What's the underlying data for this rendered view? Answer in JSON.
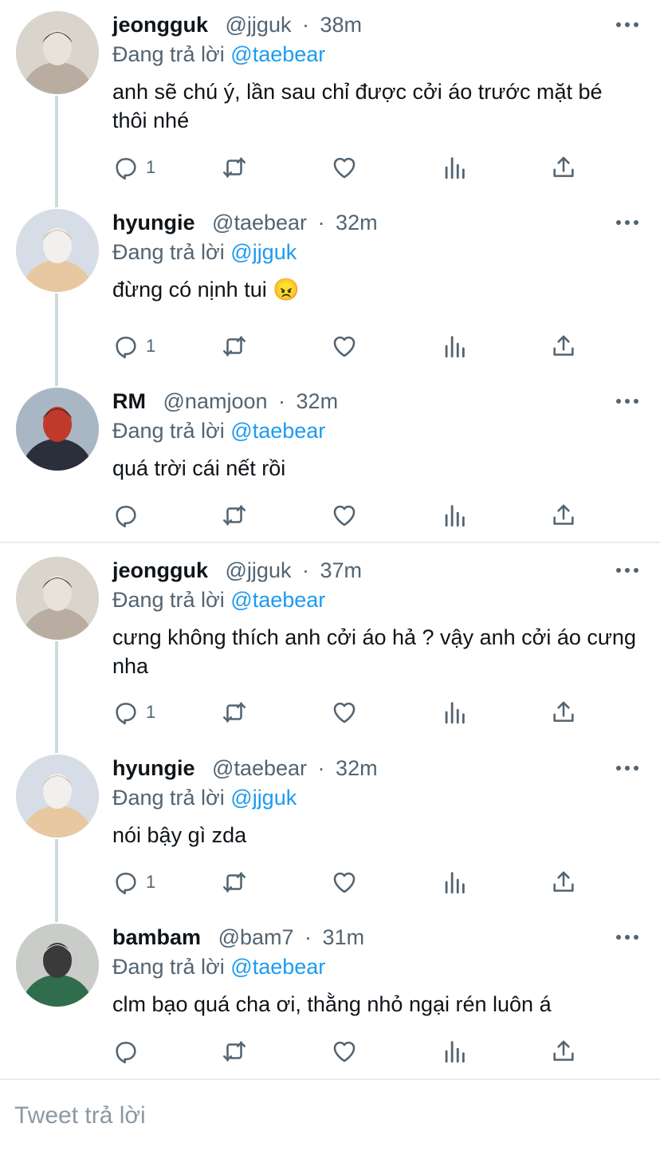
{
  "colors": {
    "text": "#0f1419",
    "secondary": "#536471",
    "accent": "#1d9bf0",
    "thread_line": "#cfd9de",
    "divider": "#e6ecf0"
  },
  "tweets": [
    {
      "name": "jeongguk",
      "handle": "@jjguk",
      "time": "38m",
      "reply_prefix": "Đang trả lời",
      "reply_to": "@taebear",
      "text": "anh sẽ chú ý, lần sau chỉ được cởi áo trước mặt bé thôi nhé",
      "reply_count": "1",
      "avatar": "avatar-jeongguk"
    },
    {
      "name": "hyungie",
      "handle": "@taebear",
      "time": "32m",
      "reply_prefix": "Đang trả lời",
      "reply_to": "@jjguk",
      "text": "đừng có nịnh tui 😠",
      "reply_count": "1",
      "avatar": "avatar-hyungie"
    },
    {
      "name": "RM",
      "handle": "@namjoon",
      "time": "32m",
      "reply_prefix": "Đang trả lời",
      "reply_to": "@taebear",
      "text": "quá trời cái nết rồi",
      "reply_count": "",
      "avatar": "avatar-rm"
    },
    {
      "name": "jeongguk",
      "handle": "@jjguk",
      "time": "37m",
      "reply_prefix": "Đang trả lời",
      "reply_to": "@taebear",
      "text": "cưng không thích anh cởi áo hả ? vậy anh cởi áo cưng nha",
      "reply_count": "1",
      "avatar": "avatar-jeongguk"
    },
    {
      "name": "hyungie",
      "handle": "@taebear",
      "time": "32m",
      "reply_prefix": "Đang trả lời",
      "reply_to": "@jjguk",
      "text": "nói bậy gì zda",
      "reply_count": "1",
      "avatar": "avatar-hyungie"
    },
    {
      "name": "bambam",
      "handle": "@bam7",
      "time": "31m",
      "reply_prefix": "Đang trả lời",
      "reply_to": "@taebear",
      "text": "clm bạo quá cha ơi, thằng nhỏ ngại rén luôn á",
      "reply_count": "",
      "avatar": "avatar-bambam"
    }
  ],
  "separator": "·",
  "icons": [
    "reply-icon",
    "retweet-icon",
    "like-icon",
    "analytics-icon",
    "share-icon",
    "more-icon"
  ],
  "compose": {
    "placeholder": "Tweet trả lời"
  }
}
